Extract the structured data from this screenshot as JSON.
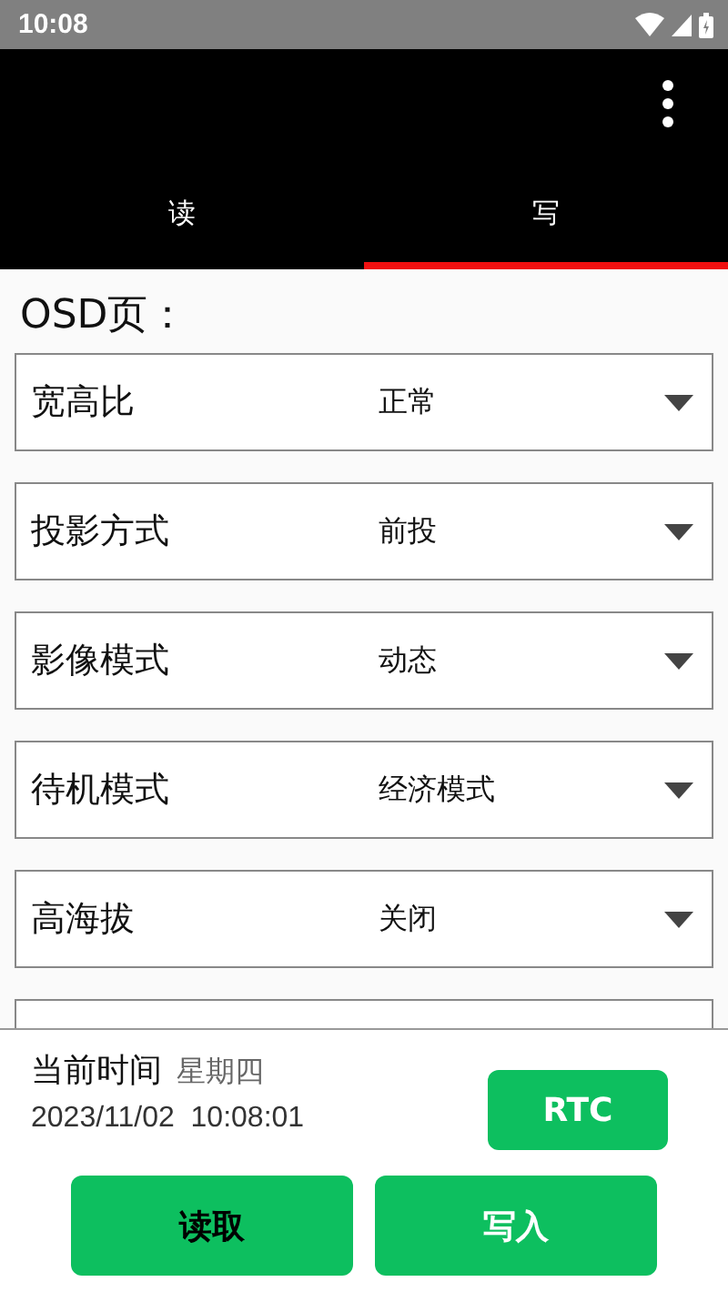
{
  "status_bar": {
    "time": "10:08"
  },
  "tabs": [
    {
      "label": "读",
      "selected": false
    },
    {
      "label": "写",
      "selected": true
    }
  ],
  "section_title": "OSD页：",
  "settings": [
    {
      "label": "宽高比",
      "value": "正常"
    },
    {
      "label": "投影方式",
      "value": "前投"
    },
    {
      "label": "影像模式",
      "value": "动态"
    },
    {
      "label": "待机模式",
      "value": "经济模式"
    },
    {
      "label": "高海拔",
      "value": "关闭"
    }
  ],
  "footer": {
    "time_label": "当前时间",
    "weekday": "星期四",
    "datetime": "2023/11/02  10:08:01",
    "rtc_button": "RTC",
    "read_button": "读取",
    "write_button": "写入"
  }
}
